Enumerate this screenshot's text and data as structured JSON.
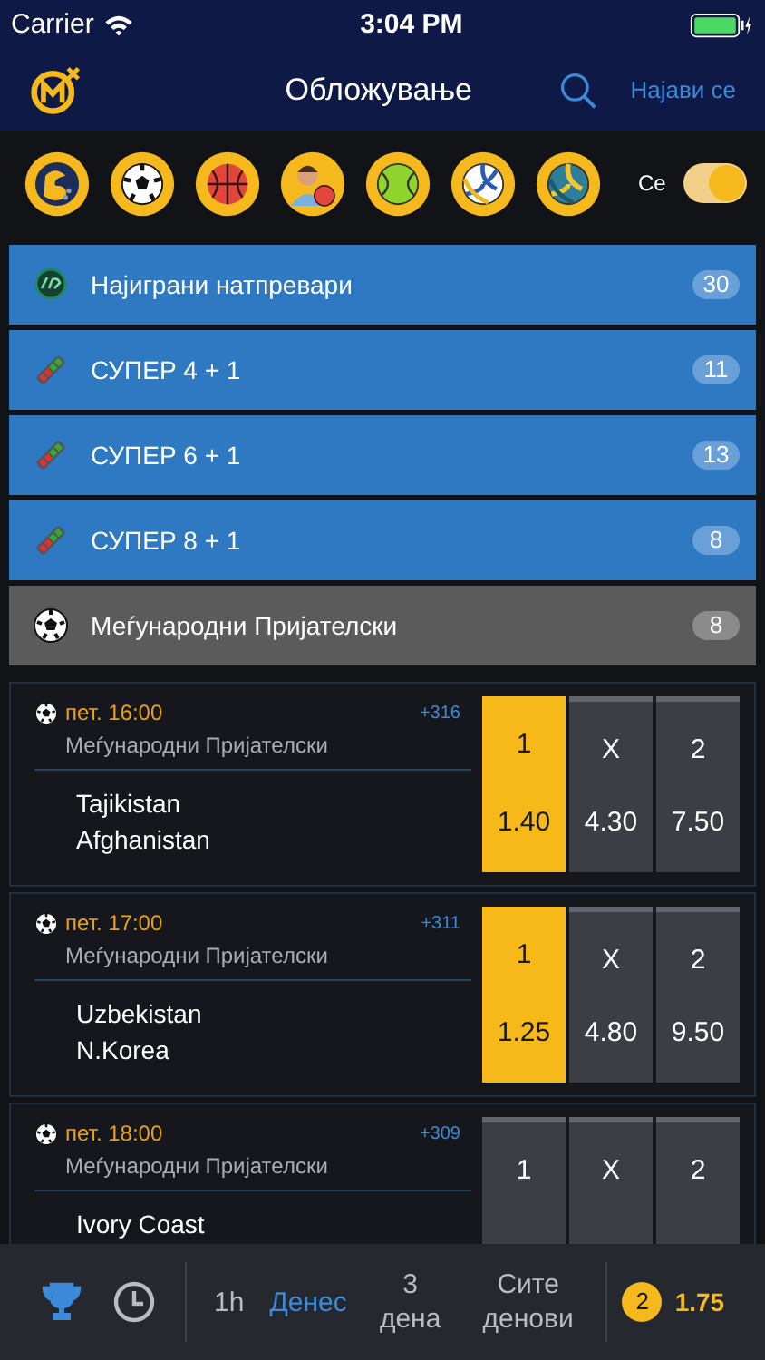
{
  "status_bar": {
    "carrier": "Carrier",
    "time": "3:04 PM"
  },
  "header": {
    "title": "Обложување",
    "login": "Најави се"
  },
  "sports": [
    {
      "kind": "super"
    },
    {
      "kind": "football"
    },
    {
      "kind": "basketball"
    },
    {
      "kind": "player"
    },
    {
      "kind": "tennis"
    },
    {
      "kind": "volleyball"
    },
    {
      "kind": "beach-volleyball"
    }
  ],
  "live_toggle": {
    "label": "Се",
    "on": true
  },
  "categories": [
    {
      "kind": "top",
      "label": "Најиграни натпревари",
      "count": "30"
    },
    {
      "kind": "super",
      "label": "СУПЕР 4 + 1",
      "count": "11"
    },
    {
      "kind": "super",
      "label": "СУПЕР 6 + 1",
      "count": "13"
    },
    {
      "kind": "super",
      "label": "СУПЕР 8 + 1",
      "count": "8"
    },
    {
      "kind": "league",
      "label": "Меѓународни Пријателски",
      "count": "8"
    }
  ],
  "matches": [
    {
      "time": "пет. 16:00",
      "more": "+316",
      "league": "Меѓународни Пријателски",
      "teams": [
        "Tajikistan",
        "Afghanistan"
      ],
      "odds": [
        {
          "label": "1",
          "value": "1.40",
          "selected": true
        },
        {
          "label": "X",
          "value": "4.30",
          "selected": false
        },
        {
          "label": "2",
          "value": "7.50",
          "selected": false
        }
      ]
    },
    {
      "time": "пет. 17:00",
      "more": "+311",
      "league": "Меѓународни Пријателски",
      "teams": [
        "Uzbekistan",
        "N.Korea"
      ],
      "odds": [
        {
          "label": "1",
          "value": "1.25",
          "selected": true
        },
        {
          "label": "X",
          "value": "4.80",
          "selected": false
        },
        {
          "label": "2",
          "value": "9.50",
          "selected": false
        }
      ]
    },
    {
      "time": "пет. 18:00",
      "more": "+309",
      "league": "Меѓународни Пријателски",
      "teams": [
        "Ivory Coast"
      ],
      "odds": [
        {
          "label": "1",
          "selected": false
        },
        {
          "label": "X",
          "selected": false
        },
        {
          "label": "2",
          "selected": false
        }
      ]
    }
  ],
  "bottom_bar": {
    "views": [
      {
        "kind": "trophy",
        "selected": true
      },
      {
        "kind": "clock",
        "selected": false
      }
    ],
    "periods": [
      {
        "label": "1h",
        "selected": false
      },
      {
        "label": "Денес",
        "selected": true
      },
      {
        "label": "3 дена",
        "selected": false
      },
      {
        "label": "Сите денови",
        "selected": false
      }
    ],
    "slip": {
      "count": "2",
      "total": "1.75"
    }
  }
}
